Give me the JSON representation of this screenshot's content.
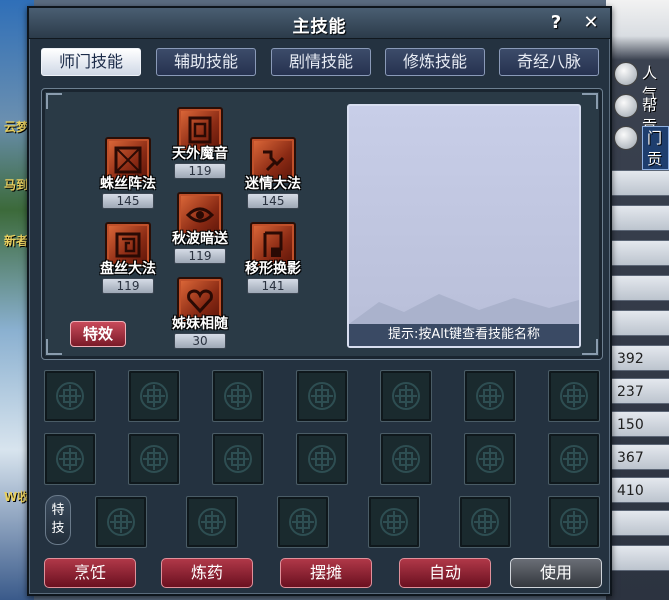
{
  "window": {
    "title": "主技能",
    "help_label": "?",
    "close_label": "✕"
  },
  "tabs": [
    {
      "label": "师门技能",
      "active": true
    },
    {
      "label": "辅助技能",
      "active": false
    },
    {
      "label": "剧情技能",
      "active": false
    },
    {
      "label": "修炼技能",
      "active": false
    },
    {
      "label": "奇经八脉",
      "active": false
    }
  ],
  "skills": [
    {
      "name": "天外魔音",
      "level": "119",
      "icon": "gate-rune-icon"
    },
    {
      "name": "蛛丝阵法",
      "level": "145",
      "icon": "web-rune-icon"
    },
    {
      "name": "迷情大法",
      "level": "145",
      "icon": "key-rune-icon"
    },
    {
      "name": "秋波暗送",
      "level": "119",
      "icon": "eye-rune-icon"
    },
    {
      "name": "盘丝大法",
      "level": "119",
      "icon": "spiral-rune-icon"
    },
    {
      "name": "移形换影",
      "level": "141",
      "icon": "shadow-rune-icon"
    },
    {
      "name": "姊妹相随",
      "level": "30",
      "icon": "heart-rune-icon"
    }
  ],
  "effect_button": "特效",
  "description": {
    "hint": "提示:按Alt键查看技能名称"
  },
  "special_button": "特技",
  "bottom_buttons": [
    {
      "label": "烹饪",
      "style": "red"
    },
    {
      "label": "炼药",
      "style": "red"
    },
    {
      "label": "摆摊",
      "style": "red"
    },
    {
      "label": "自动",
      "style": "red"
    },
    {
      "label": "使用",
      "style": "gray"
    }
  ],
  "background": {
    "left_fragments": [
      "云梦",
      "马到",
      "新者",
      "W收"
    ],
    "right_options": [
      {
        "label": "人气"
      },
      {
        "label": "帮贡"
      },
      {
        "label": "门贡",
        "boxed": true
      }
    ],
    "right_values": [
      "392",
      "237",
      "150",
      "367",
      "410"
    ]
  },
  "colors": {
    "window_bg": "#243240",
    "active_tab": "#ffffff",
    "skill_icon": "#b8401e",
    "red_button": "#8a1f30",
    "gray_button": "#4a4e54"
  }
}
